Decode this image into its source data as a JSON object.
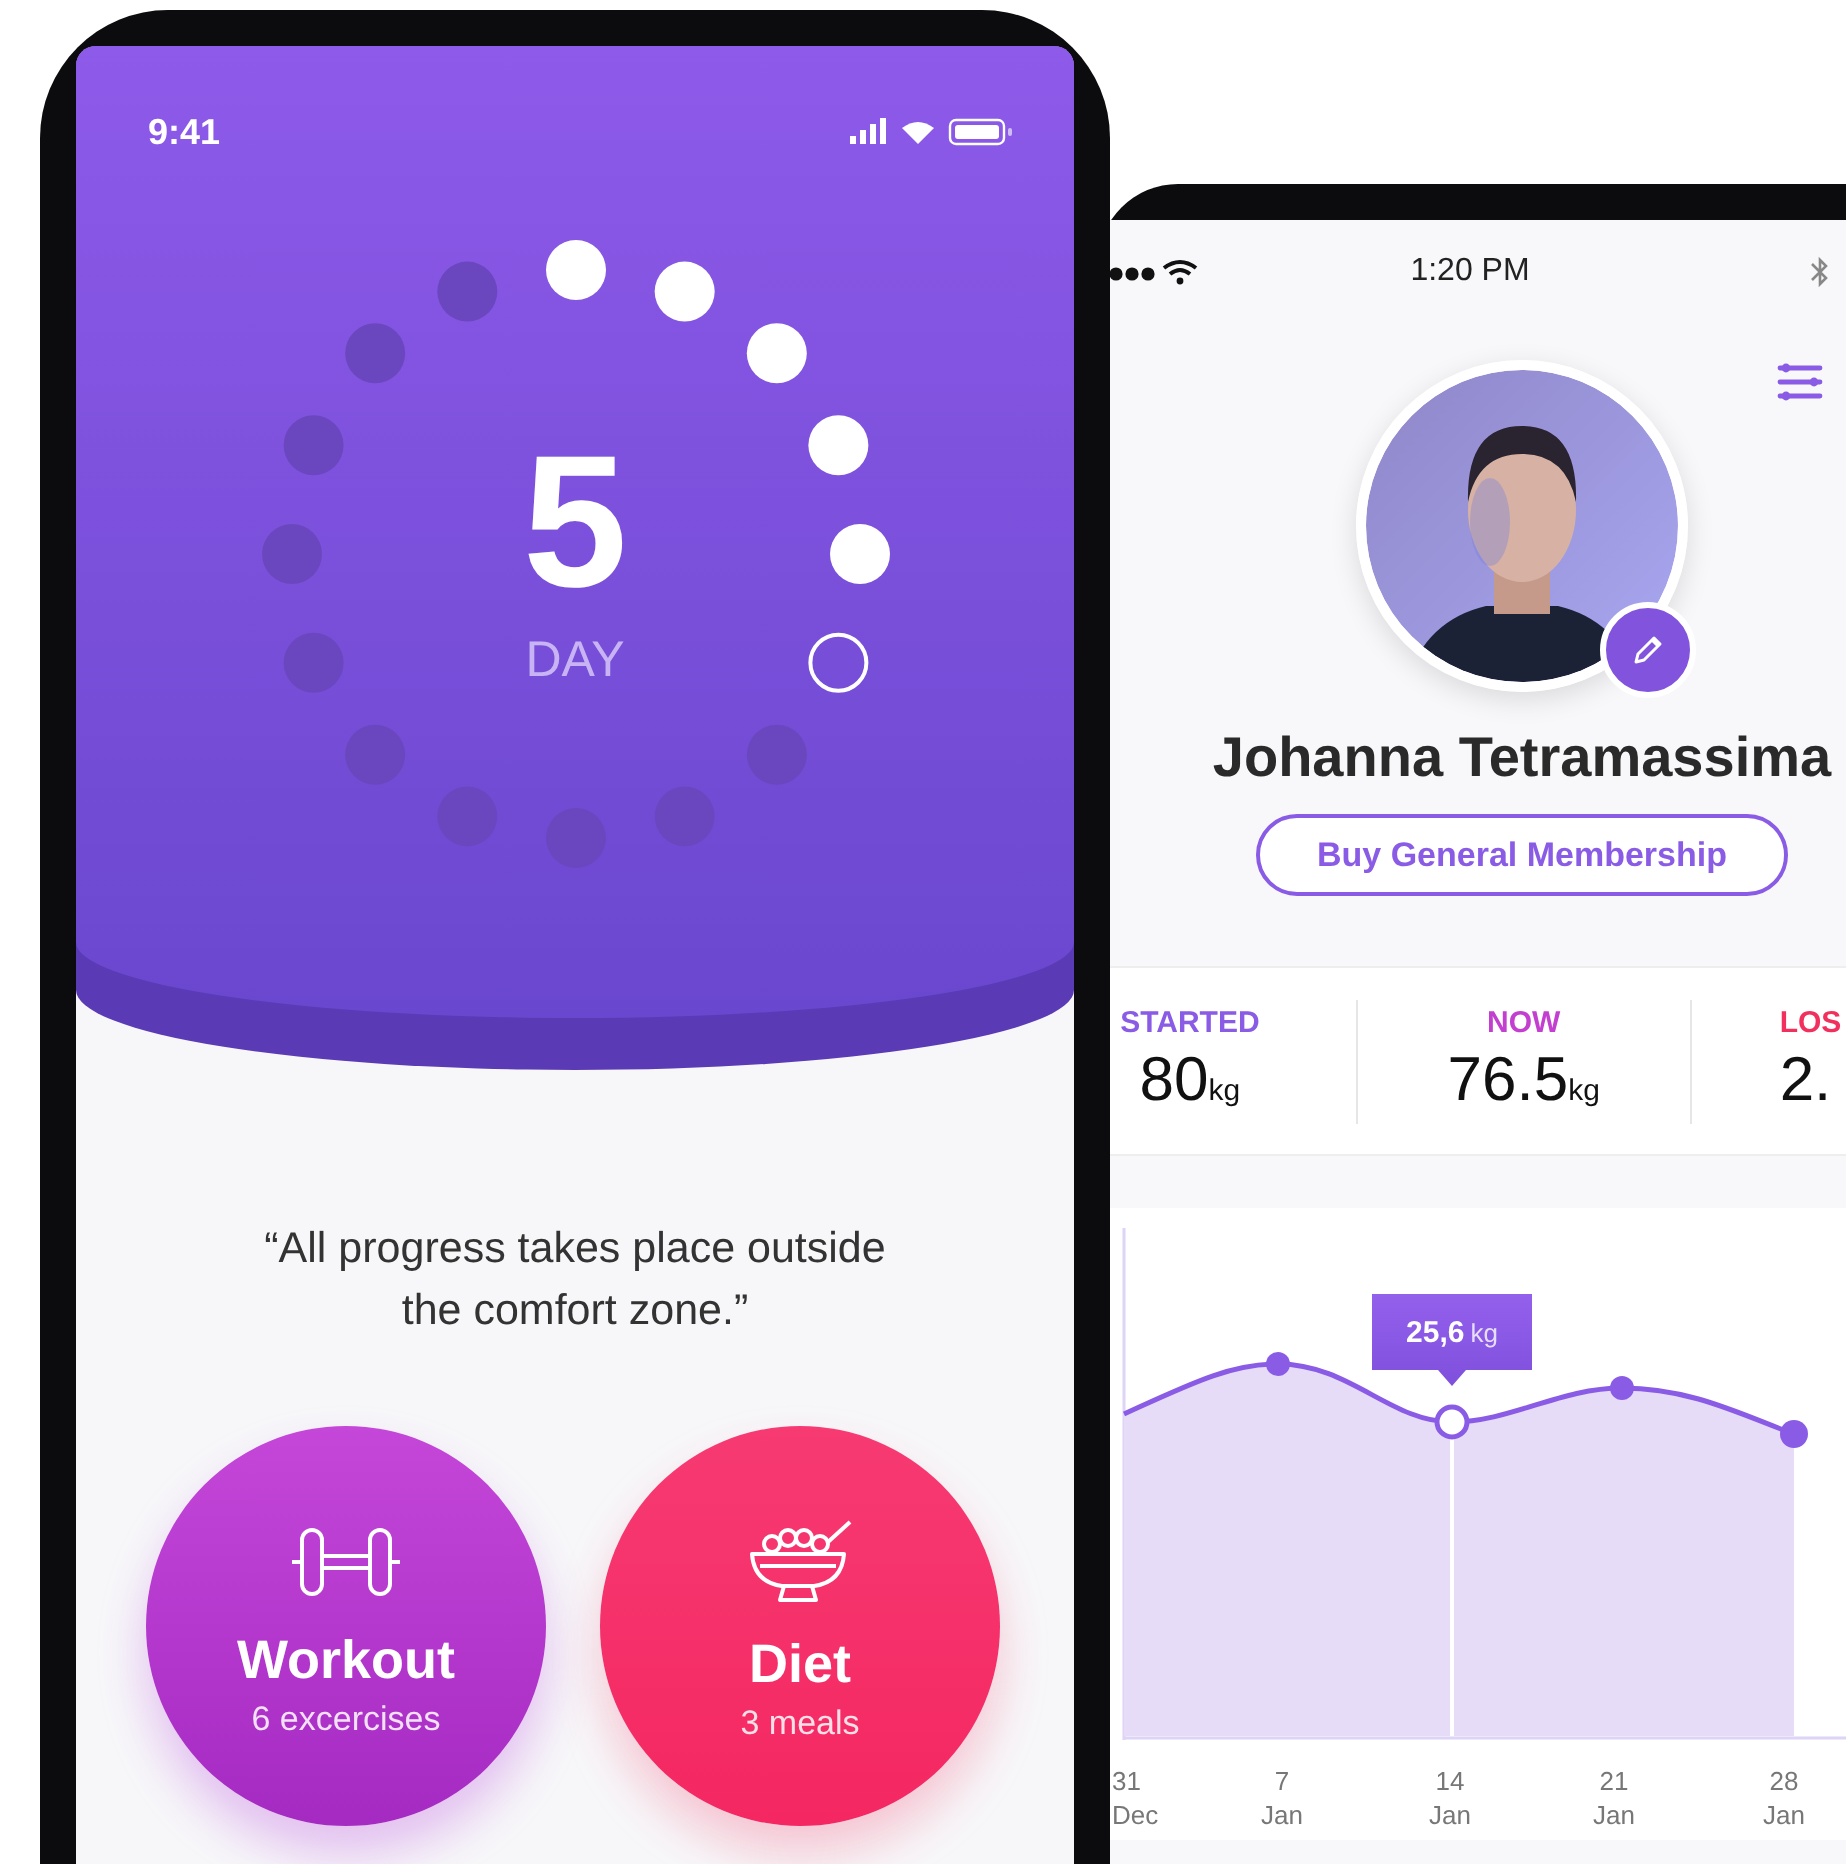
{
  "left_phone": {
    "status_bar": {
      "time": "9:41"
    },
    "day_counter": {
      "number": "5",
      "label": "DAY",
      "dots": [
        {
          "done": true,
          "current": false
        },
        {
          "done": true,
          "current": false
        },
        {
          "done": true,
          "current": false
        },
        {
          "done": true,
          "current": false
        },
        {
          "done": true,
          "current": false
        },
        {
          "done": false,
          "current": true
        },
        {
          "done": false,
          "current": false
        },
        {
          "done": false,
          "current": false
        },
        {
          "done": false,
          "current": false
        },
        {
          "done": false,
          "current": false
        },
        {
          "done": false,
          "current": false
        },
        {
          "done": false,
          "current": false
        },
        {
          "done": false,
          "current": false
        },
        {
          "done": false,
          "current": false
        },
        {
          "done": false,
          "current": false
        },
        {
          "done": false,
          "current": false
        }
      ]
    },
    "quote": "“All progress takes place outside the comfort zone.”",
    "tiles": [
      {
        "kind": "workout",
        "title": "Workout",
        "subtitle": "6 excercises"
      },
      {
        "kind": "diet",
        "title": "Diet",
        "subtitle": "3 meals"
      }
    ]
  },
  "right_phone": {
    "status_bar": {
      "time": "1:20 PM"
    },
    "profile": {
      "name": "Johanna Tetramassima",
      "button": "Buy General Membership"
    },
    "stats": [
      {
        "label": "STARTED",
        "value": "80",
        "unit": "kg",
        "color": "#8a5ce6"
      },
      {
        "label": "NOW",
        "value": "76.5",
        "unit": "kg",
        "color": "#c33fd0"
      },
      {
        "label": "LOS",
        "value": "2.",
        "color": "#f2305e"
      }
    ],
    "chart": {
      "tooltip": {
        "value": "25,6",
        "unit": "kg"
      },
      "x_labels": [
        {
          "day": "31",
          "month": "Dec"
        },
        {
          "day": "7",
          "month": "Jan"
        },
        {
          "day": "14",
          "month": "Jan"
        },
        {
          "day": "21",
          "month": "Jan"
        },
        {
          "day": "28",
          "month": "Jan"
        }
      ]
    }
  }
}
